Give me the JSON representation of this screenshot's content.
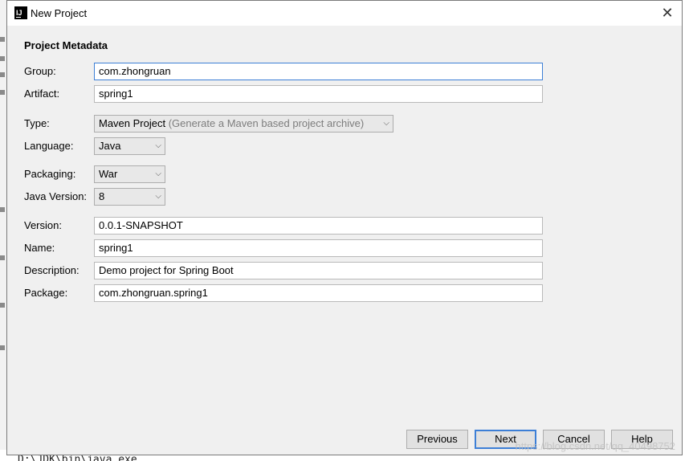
{
  "window": {
    "icon_text": "IJ",
    "title": "New Project",
    "close_glyph": "✕"
  },
  "section_title": "Project Metadata",
  "form": {
    "group": {
      "label": "Group:",
      "value": "com.zhongruan"
    },
    "artifact": {
      "label": "Artifact:",
      "value": "spring1"
    },
    "type": {
      "label": "Type:",
      "value": "Maven Project",
      "hint": "(Generate a Maven based project archive)"
    },
    "language": {
      "label": "Language:",
      "value": "Java"
    },
    "packaging": {
      "label": "Packaging:",
      "value": "War"
    },
    "java_version": {
      "label": "Java Version:",
      "value": "8"
    },
    "version": {
      "label": "Version:",
      "value": "0.0.1-SNAPSHOT"
    },
    "name": {
      "label": "Name:",
      "value": "spring1"
    },
    "description": {
      "label": "Description:",
      "value": "Demo project for Spring Boot"
    },
    "package": {
      "label": "Package:",
      "value": "com.zhongruan.spring1"
    }
  },
  "buttons": {
    "previous": "Previous",
    "next": "Next",
    "cancel": "Cancel",
    "help": "Help"
  },
  "watermark": "https://blog.csdn.net/qq_40498752",
  "background": {
    "console_text": "D:\\JDK\\bin\\java.exe"
  },
  "colors": {
    "focus_border": "#3d7fd6",
    "dialog_bg": "#f0f0f0"
  }
}
